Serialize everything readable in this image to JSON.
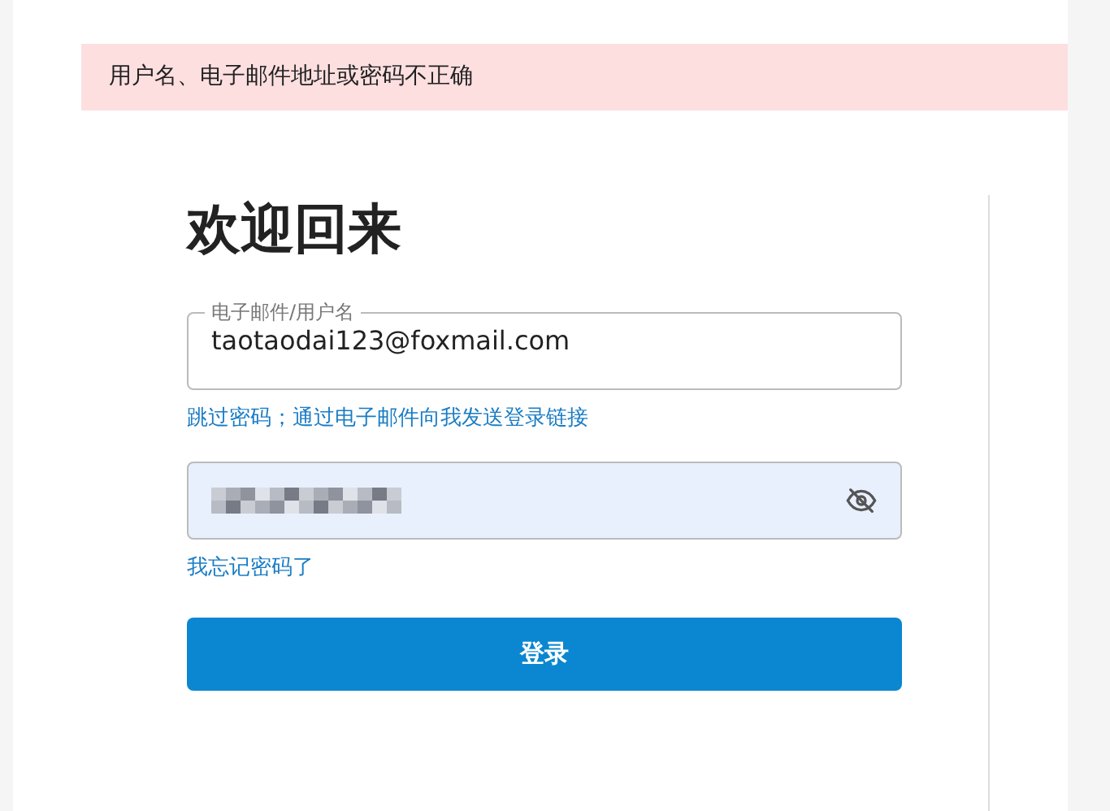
{
  "alert": {
    "message": "用户名、电子邮件地址或密码不正确"
  },
  "heading": "欢迎回来",
  "email_field": {
    "label": "电子邮件/用户名",
    "value": "taotaodai123@foxmail.com"
  },
  "magic_link": "跳过密码；通过电子邮件向我发送登录链接",
  "password_field": {
    "redacted": true,
    "autofilled": true
  },
  "forgot_link": "我忘记密码了",
  "submit_button": "登录"
}
